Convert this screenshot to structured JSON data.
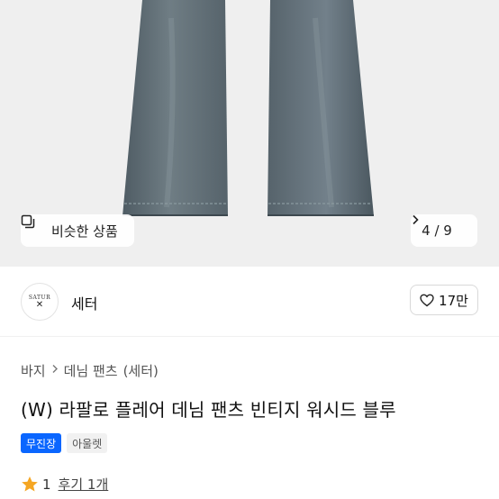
{
  "gallery": {
    "similar_label": "비슷한 상품",
    "similar_icon": "copy-icon",
    "pager_text": "4 / 9",
    "pager_icon": "chevron-right-icon"
  },
  "brand": {
    "logo_text": "SATUR",
    "logo_mark": "✕",
    "name": "세터",
    "likes": "17만",
    "like_icon": "heart-icon"
  },
  "breadcrumb": {
    "items": [
      "바지",
      "데님 팬츠",
      "(세터)"
    ],
    "separator_icon": "chevron-right-icon"
  },
  "product": {
    "title": "(W) 라팔로 플레어 데님 팬츠 빈티지 워시드 블루",
    "badges": [
      "무진장",
      "아울렛"
    ],
    "rating": "1",
    "rating_icon": "star-icon",
    "review_text": "후기 1개"
  },
  "colors": {
    "accent": "#0a66ff",
    "star": "#f5a623",
    "denim": "#5b6870"
  }
}
